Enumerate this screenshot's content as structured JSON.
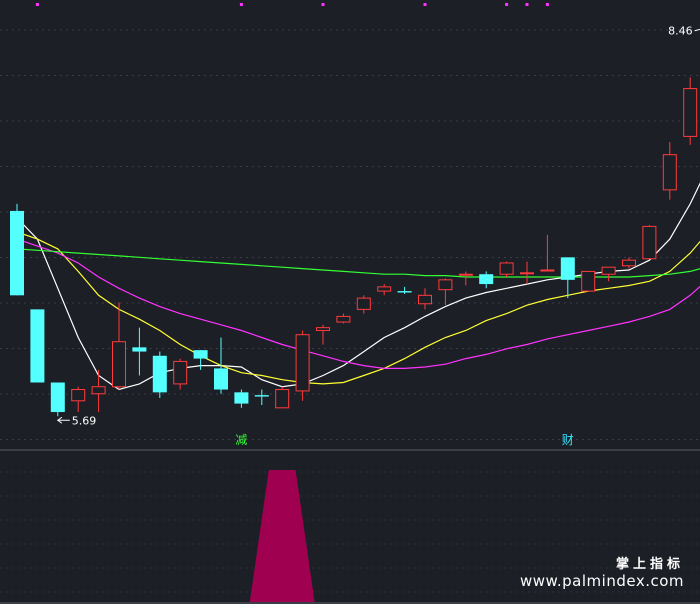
{
  "chart_data": {
    "type": "candlestick",
    "candles": [
      {
        "o": 7.15,
        "h": 7.2,
        "l": 6.55,
        "c": 6.55
      },
      {
        "o": 6.45,
        "h": 6.45,
        "l": 5.93,
        "c": 5.93
      },
      {
        "o": 5.93,
        "h": 5.93,
        "l": 5.69,
        "c": 5.72
      },
      {
        "o": 5.8,
        "h": 5.9,
        "l": 5.72,
        "c": 5.88
      },
      {
        "o": 5.85,
        "h": 6.02,
        "l": 5.72,
        "c": 5.9
      },
      {
        "o": 5.9,
        "h": 6.5,
        "l": 5.88,
        "c": 6.22
      },
      {
        "o": 6.18,
        "h": 6.32,
        "l": 5.98,
        "c": 6.15
      },
      {
        "o": 6.12,
        "h": 6.15,
        "l": 5.82,
        "c": 5.86
      },
      {
        "o": 5.92,
        "h": 6.1,
        "l": 5.88,
        "c": 6.08
      },
      {
        "o": 6.16,
        "h": 6.16,
        "l": 6.02,
        "c": 6.1
      },
      {
        "o": 6.03,
        "h": 6.25,
        "l": 5.85,
        "c": 5.88
      },
      {
        "o": 5.86,
        "h": 5.88,
        "l": 5.75,
        "c": 5.78
      },
      {
        "o": 5.84,
        "h": 5.88,
        "l": 5.77,
        "c": 5.83
      },
      {
        "o": 5.75,
        "h": 5.9,
        "l": 5.75,
        "c": 5.88
      },
      {
        "o": 5.87,
        "h": 6.3,
        "l": 5.8,
        "c": 6.27
      },
      {
        "o": 6.3,
        "h": 6.34,
        "l": 6.2,
        "c": 6.32
      },
      {
        "o": 6.36,
        "h": 6.42,
        "l": 6.35,
        "c": 6.4
      },
      {
        "o": 6.45,
        "h": 6.55,
        "l": 6.42,
        "c": 6.53
      },
      {
        "o": 6.58,
        "h": 6.63,
        "l": 6.55,
        "c": 6.61
      },
      {
        "o": 6.58,
        "h": 6.61,
        "l": 6.56,
        "c": 6.57
      },
      {
        "o": 6.49,
        "h": 6.6,
        "l": 6.45,
        "c": 6.55
      },
      {
        "o": 6.59,
        "h": 6.67,
        "l": 6.48,
        "c": 6.66
      },
      {
        "o": 6.7,
        "h": 6.72,
        "l": 6.62,
        "c": 6.7
      },
      {
        "o": 6.7,
        "h": 6.72,
        "l": 6.6,
        "c": 6.63
      },
      {
        "o": 6.7,
        "h": 6.79,
        "l": 6.68,
        "c": 6.78
      },
      {
        "o": 6.71,
        "h": 6.79,
        "l": 6.63,
        "c": 6.71
      },
      {
        "o": 6.73,
        "h": 6.98,
        "l": 6.72,
        "c": 6.73
      },
      {
        "o": 6.82,
        "h": 6.82,
        "l": 6.53,
        "c": 6.66
      },
      {
        "o": 6.58,
        "h": 6.72,
        "l": 6.58,
        "c": 6.72
      },
      {
        "o": 6.7,
        "h": 6.75,
        "l": 6.65,
        "c": 6.75
      },
      {
        "o": 6.76,
        "h": 6.82,
        "l": 6.74,
        "c": 6.8
      },
      {
        "o": 6.81,
        "h": 7.05,
        "l": 6.81,
        "c": 7.04
      },
      {
        "o": 7.3,
        "h": 7.64,
        "l": 7.23,
        "c": 7.55
      },
      {
        "o": 7.68,
        "h": 8.1,
        "l": 7.62,
        "c": 8.02
      },
      {
        "o": 7.9,
        "h": 8.46,
        "l": 7.9,
        "c": 8.4
      }
    ],
    "ma_series": [
      {
        "color": "#ffffff",
        "values": [
          7.1,
          6.95,
          6.6,
          6.25,
          5.98,
          5.88,
          5.92,
          6.0,
          6.03,
          6.05,
          6.05,
          6.04,
          5.95,
          5.9,
          5.92,
          5.98,
          6.05,
          6.15,
          6.25,
          6.32,
          6.4,
          6.47,
          6.53,
          6.57,
          6.6,
          6.63,
          6.66,
          6.68,
          6.7,
          6.72,
          6.73,
          6.8,
          6.95,
          7.2,
          7.5
        ]
      },
      {
        "color": "#ffff33",
        "values": [
          7.0,
          6.95,
          6.88,
          6.72,
          6.55,
          6.45,
          6.38,
          6.3,
          6.2,
          6.12,
          6.05,
          6.0,
          5.98,
          5.95,
          5.93,
          5.92,
          5.93,
          5.98,
          6.03,
          6.1,
          6.18,
          6.25,
          6.3,
          6.37,
          6.42,
          6.48,
          6.52,
          6.55,
          6.58,
          6.6,
          6.62,
          6.65,
          6.72,
          6.85,
          7.02
        ]
      },
      {
        "color": "#ff33ff",
        "values": [
          6.95,
          6.9,
          6.85,
          6.78,
          6.68,
          6.6,
          6.53,
          6.47,
          6.42,
          6.38,
          6.34,
          6.3,
          6.25,
          6.2,
          6.16,
          6.12,
          6.08,
          6.05,
          6.03,
          6.03,
          6.04,
          6.06,
          6.1,
          6.13,
          6.17,
          6.2,
          6.24,
          6.27,
          6.3,
          6.33,
          6.36,
          6.4,
          6.45,
          6.55,
          6.68
        ]
      },
      {
        "color": "#33ff33",
        "values": [
          6.88,
          6.87,
          6.86,
          6.85,
          6.84,
          6.83,
          6.82,
          6.81,
          6.8,
          6.79,
          6.78,
          6.77,
          6.76,
          6.75,
          6.74,
          6.73,
          6.72,
          6.71,
          6.7,
          6.7,
          6.69,
          6.69,
          6.68,
          6.68,
          6.68,
          6.68,
          6.68,
          6.68,
          6.68,
          6.68,
          6.68,
          6.69,
          6.7,
          6.72,
          6.76
        ]
      }
    ],
    "ylim": [
      5.45,
      8.65
    ],
    "annotations": [
      {
        "index": 2,
        "text": "5.69",
        "anchor": "low",
        "value": 5.69
      },
      {
        "index": 34,
        "text": "8.46",
        "anchor": "high",
        "value": 8.46
      }
    ],
    "markers": [
      {
        "index": 11,
        "text": "减",
        "color": "#33ff33"
      },
      {
        "index": 27,
        "text": "财",
        "color": "#33e6ff"
      }
    ],
    "top_dots": [
      1,
      11,
      15,
      20,
      24,
      25,
      26
    ],
    "indicator": {
      "color": "#a00050",
      "start_index": 12,
      "end_index": 14
    }
  },
  "watermark": {
    "line1": "掌上指标",
    "line2": "www.palmindex.com"
  }
}
